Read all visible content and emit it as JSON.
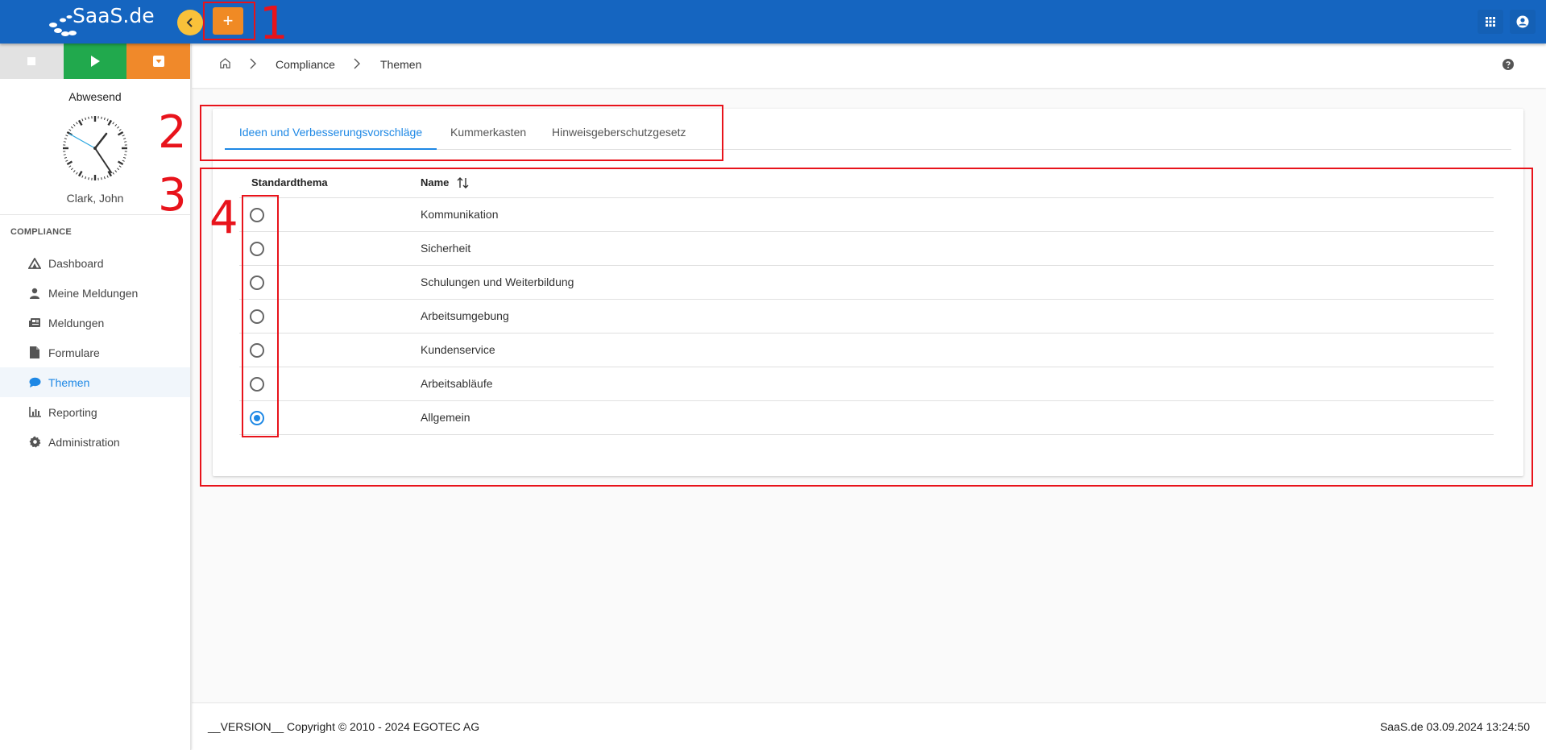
{
  "header": {
    "logo_text": "SaaS.de",
    "collapse_icon": "chevron-left-icon",
    "add_label": "+",
    "apps_icon": "apps-grid-icon",
    "user_icon": "account-circle-icon",
    "colors": {
      "bar": "#1565c0",
      "accent_orange": "#f08a24",
      "accent_yellow": "#f9c13a"
    }
  },
  "annotations": [
    "1",
    "2",
    "3",
    "4"
  ],
  "sidebar": {
    "controls": [
      "stop-icon",
      "play-icon",
      "pause-icon"
    ],
    "status": "Abwesend",
    "user_name": "Clark, John",
    "section_title": "COMPLIANCE",
    "items": [
      {
        "label": "Dashboard",
        "icon": "dashboard-icon",
        "active": false
      },
      {
        "label": "Meine Meldungen",
        "icon": "person-icon",
        "active": false
      },
      {
        "label": "Meldungen",
        "icon": "newspaper-icon",
        "active": false
      },
      {
        "label": "Formulare",
        "icon": "file-icon",
        "active": false
      },
      {
        "label": "Themen",
        "icon": "chat-bubble-icon",
        "active": true
      },
      {
        "label": "Reporting",
        "icon": "bar-chart-icon",
        "active": false
      },
      {
        "label": "Administration",
        "icon": "gear-icon",
        "active": false
      }
    ]
  },
  "breadcrumb": {
    "home_icon": "home-icon",
    "items": [
      "Compliance",
      "Themen"
    ],
    "help_icon": "help-circle-icon"
  },
  "tabs": [
    {
      "label": "Ideen und Verbesserungsvorschläge",
      "active": true
    },
    {
      "label": "Kummerkasten",
      "active": false
    },
    {
      "label": "Hinweisgeberschutzgesetz",
      "active": false
    }
  ],
  "table": {
    "columns": [
      "Standardthema",
      "Name"
    ],
    "sort_icon": "sort-arrows-icon",
    "rows": [
      {
        "name": "Kommunikation",
        "default": false
      },
      {
        "name": "Sicherheit",
        "default": false
      },
      {
        "name": "Schulungen und Weiterbildung",
        "default": false
      },
      {
        "name": "Arbeitsumgebung",
        "default": false
      },
      {
        "name": "Kundenservice",
        "default": false
      },
      {
        "name": "Arbeitsabläufe",
        "default": false
      },
      {
        "name": "Allgemein",
        "default": true
      }
    ]
  },
  "footer": {
    "copyright": "__VERSION__ Copyright © 2010 - 2024 EGOTEC AG",
    "right_text": "SaaS.de  03.09.2024 13:24:50"
  }
}
